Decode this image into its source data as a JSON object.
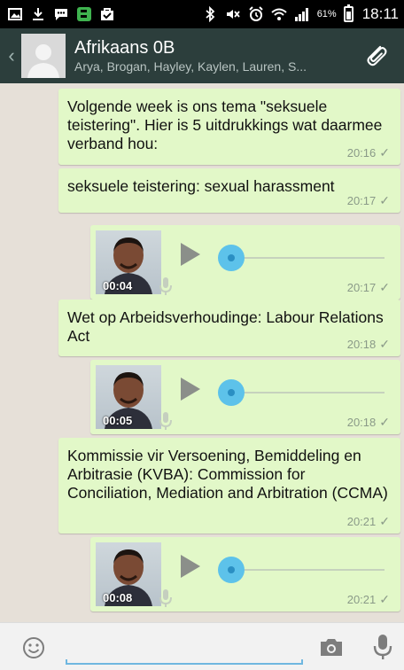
{
  "status_bar": {
    "icons_left": [
      "image-icon",
      "download-icon",
      "chat-notification-icon",
      "bbm-icon",
      "bag-icon"
    ],
    "icons_right": [
      "bluetooth-icon",
      "mute-icon",
      "alarm-icon",
      "wifi-icon",
      "signal-icon"
    ],
    "battery_percent": "61%",
    "time": "18:11"
  },
  "header": {
    "title": "Afrikaans 0B",
    "subtitle": "Arya, Brogan, Hayley, Kaylen, Lauren, S..."
  },
  "messages": [
    {
      "type": "text",
      "text": "Volgende week is ons tema \"seksuele teistering\". Hier is 5 uitdrukkings wat daarmee verband hou:",
      "time": "20:16"
    },
    {
      "type": "text",
      "text": "seksuele teistering: sexual harassment",
      "time": "20:17"
    },
    {
      "type": "audio",
      "duration": "00:04",
      "time": "20:17"
    },
    {
      "type": "text",
      "text": "Wet op Arbeidsverhoudinge: Labour Relations Act",
      "time": "20:18"
    },
    {
      "type": "audio",
      "duration": "00:05",
      "time": "20:18"
    },
    {
      "type": "text",
      "text": "Kommissie vir Versoening, Bemiddeling en Arbitrasie (KVBA): Commission for Conciliation,  Mediation and Arbitration (CCMA)",
      "time": "20:21"
    },
    {
      "type": "audio",
      "duration": "00:08",
      "time": "20:21"
    }
  ],
  "input": {
    "placeholder": "",
    "value": ""
  },
  "colors": {
    "header": "#2c3e3c",
    "bubble": "#e2f8c8",
    "accent": "#5dc2ea"
  }
}
